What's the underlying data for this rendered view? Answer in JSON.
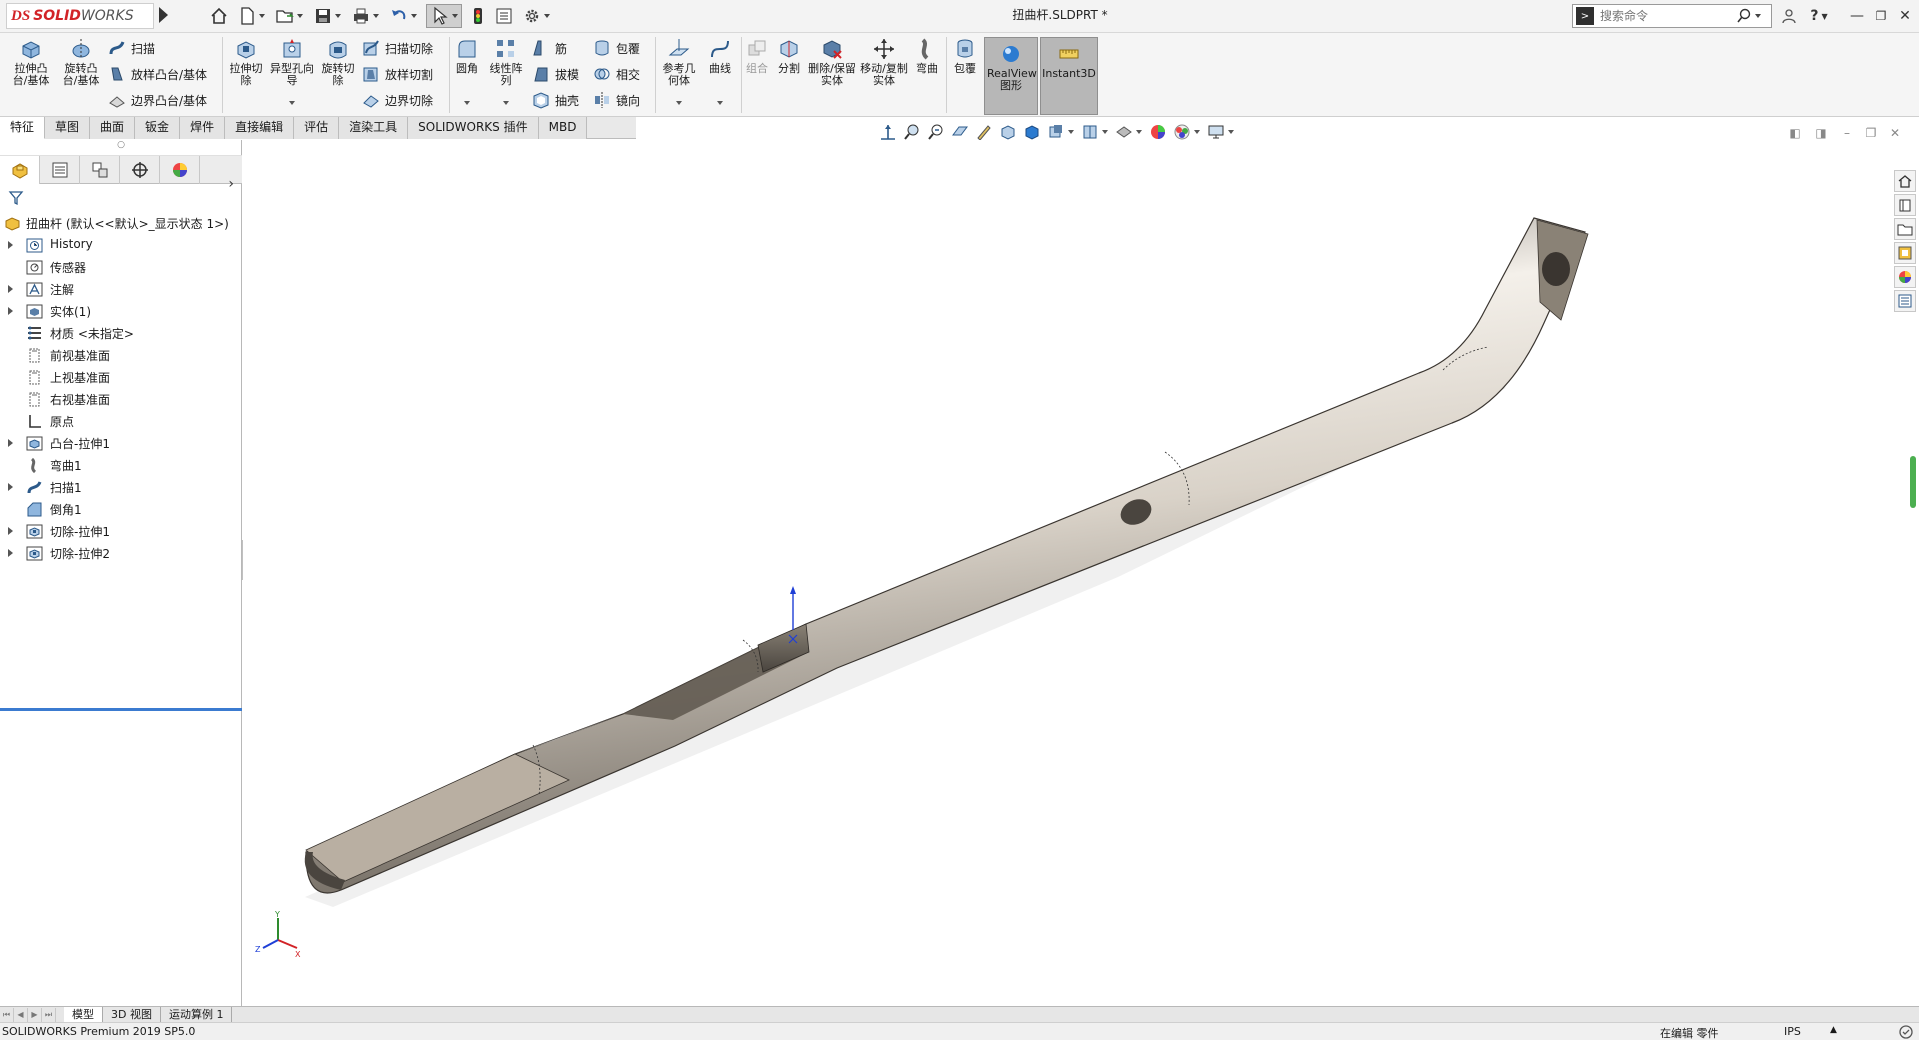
{
  "app": {
    "brand_prefix": "DS",
    "brand_name": "SOLID",
    "brand_suffix": "WORKS",
    "document_title": "扭曲杆.SLDPRT *"
  },
  "search": {
    "placeholder": "搜索命令"
  },
  "ribbon": {
    "extrude_boss": "拉伸凸台/基体",
    "revolve_boss": "旋转凸台/基体",
    "sweep": "扫描",
    "loft_boss": "放样凸台/基体",
    "boundary_boss": "边界凸台/基体",
    "extrude_cut": "拉伸切除",
    "hole_wizard": "异型孔向导",
    "revolve_cut": "旋转切除",
    "swept_cut": "扫描切除",
    "lofted_cut": "放样切割",
    "boundary_cut": "边界切除",
    "fillet": "圆角",
    "linear_pattern": "线性阵列",
    "rib": "筋",
    "draft": "拔模",
    "shell": "抽壳",
    "wrap": "包覆",
    "intersect": "相交",
    "mirror": "镜向",
    "ref_geometry": "参考几何体",
    "curves": "曲线",
    "combine": "组合",
    "split": "分割",
    "delete_keep_body": "删除/保留实体",
    "move_copy_body": "移动/复制实体",
    "flex": "弯曲",
    "wrap2": "包覆",
    "realview": "RealView图形",
    "instant3d": "Instant3D"
  },
  "tabs": [
    "特征",
    "草图",
    "曲面",
    "钣金",
    "焊件",
    "直接编辑",
    "评估",
    "渲染工具",
    "SOLIDWORKS 插件",
    "MBD"
  ],
  "tree": {
    "root": "扭曲杆 (默认<<默认>_显示状态 1>)",
    "items": [
      {
        "label": "History",
        "expandable": true,
        "icon": "history-icon"
      },
      {
        "label": "传感器",
        "expandable": false,
        "icon": "sensor-icon"
      },
      {
        "label": "注解",
        "expandable": true,
        "icon": "annotation-icon"
      },
      {
        "label": "实体(1)",
        "expandable": true,
        "icon": "solid-body-icon"
      },
      {
        "label": "材质 <未指定>",
        "expandable": false,
        "icon": "material-icon"
      },
      {
        "label": "前视基准面",
        "expandable": false,
        "icon": "plane-icon"
      },
      {
        "label": "上视基准面",
        "expandable": false,
        "icon": "plane-icon"
      },
      {
        "label": "右视基准面",
        "expandable": false,
        "icon": "plane-icon"
      },
      {
        "label": "原点",
        "expandable": false,
        "icon": "origin-icon"
      },
      {
        "label": "凸台-拉伸1",
        "expandable": true,
        "icon": "extrude-icon"
      },
      {
        "label": "弯曲1",
        "expandable": false,
        "icon": "flex-icon"
      },
      {
        "label": "扫描1",
        "expandable": true,
        "icon": "sweep-icon"
      },
      {
        "label": "倒角1",
        "expandable": false,
        "icon": "chamfer-icon"
      },
      {
        "label": "切除-拉伸1",
        "expandable": true,
        "icon": "cut-extrude-icon"
      },
      {
        "label": "切除-拉伸2",
        "expandable": true,
        "icon": "cut-extrude-icon"
      }
    ]
  },
  "bottom_tabs": [
    "模型",
    "3D 视图",
    "运动算例 1"
  ],
  "status": {
    "product": "SOLIDWORKS Premium 2019 SP5.0",
    "mode": "在编辑 零件",
    "units": "IPS",
    "units_dd": "▲"
  },
  "triad": {
    "x": "X",
    "y": "Y",
    "z": "Z"
  },
  "colors": {
    "accent": "#d22327",
    "rollback_bar": "#3b7bd0",
    "scroll_indicator": "#4caf50"
  }
}
